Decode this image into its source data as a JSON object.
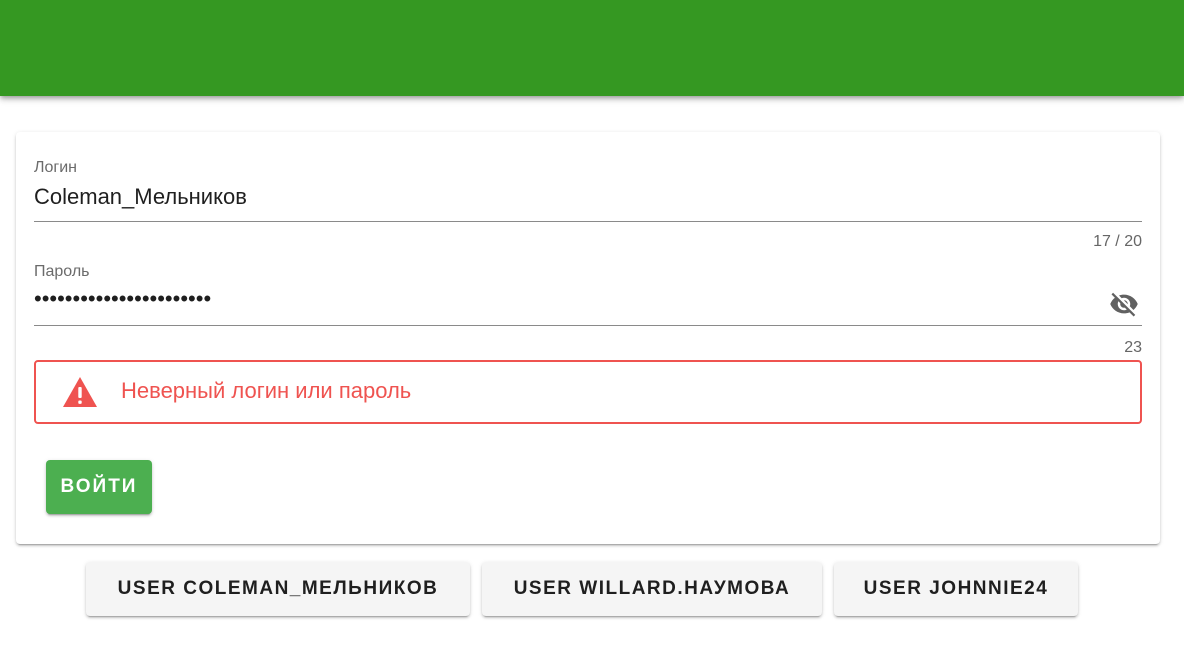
{
  "header": {
    "bg_color": "#359822"
  },
  "form": {
    "login": {
      "label": "Логин",
      "value": "Coleman_Мельников",
      "counter": "17 / 20"
    },
    "password": {
      "label": "Пароль",
      "masked_value": "•••••••••••••••••••••••",
      "counter": "23",
      "toggle_icon": "eye-off-icon"
    },
    "error": {
      "icon": "warning-icon",
      "message": "Неверный логин или пароль",
      "color": "#ef5350"
    },
    "submit_label": "ВОЙТИ",
    "submit_color": "#4caf50"
  },
  "quick_users": [
    {
      "label": "USER COLEMAN_МЕЛЬНИКОВ"
    },
    {
      "label": "USER WILLARD.НАУМОВА"
    },
    {
      "label": "USER JOHNNIE24"
    }
  ]
}
